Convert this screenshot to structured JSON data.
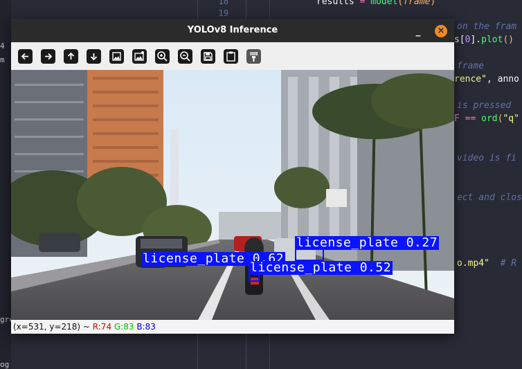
{
  "editor": {
    "line_numbers": [
      "18",
      "19"
    ],
    "left_fragments": [
      "4",
      "m",
      "grc",
      "og"
    ],
    "code": {
      "line0_a": "results",
      "line0_b": " = ",
      "line0_c": "model",
      "line0_d": "(",
      "line0_e": "frame",
      "line0_f": ")",
      "line1": "on the fram",
      "line2_a": "s[",
      "line2_b": "0",
      "line2_c": "].",
      "line2_d": "plot",
      "line2_e": "()",
      "line3": "frame",
      "line4_a": "rence\"",
      "line4_b": ", anno",
      "line5": "is pressed",
      "line6_a": "F == ",
      "line6_b": "ord",
      "line6_c": "(",
      "line6_d": "\"q\"",
      "line7": "video is fi",
      "line8": "ect and clos",
      "line9_a": "o.mp4\"",
      "line9_b": "  # R"
    }
  },
  "window": {
    "title": "YOLOv8 Inference",
    "minimize_label": "_",
    "close_label": "×"
  },
  "toolbar": {
    "buttons": [
      "pan-left",
      "pan-right",
      "pan-up",
      "pan-down",
      "zoom-fit",
      "zoom-original",
      "zoom-in",
      "zoom-out",
      "save-image",
      "copy-clipboard",
      "properties"
    ]
  },
  "detections": [
    {
      "label": "license_plate 0.27"
    },
    {
      "label": "license_plate 0.62"
    },
    {
      "label": "license_plate 0.52"
    }
  ],
  "status": {
    "coords": "(x=531, y=218) ~ ",
    "r": "R:74",
    "g": "G:83",
    "b": "B:83",
    "r_color": "#e00000",
    "g_color": "#00c000",
    "b_color": "#0000e0"
  }
}
